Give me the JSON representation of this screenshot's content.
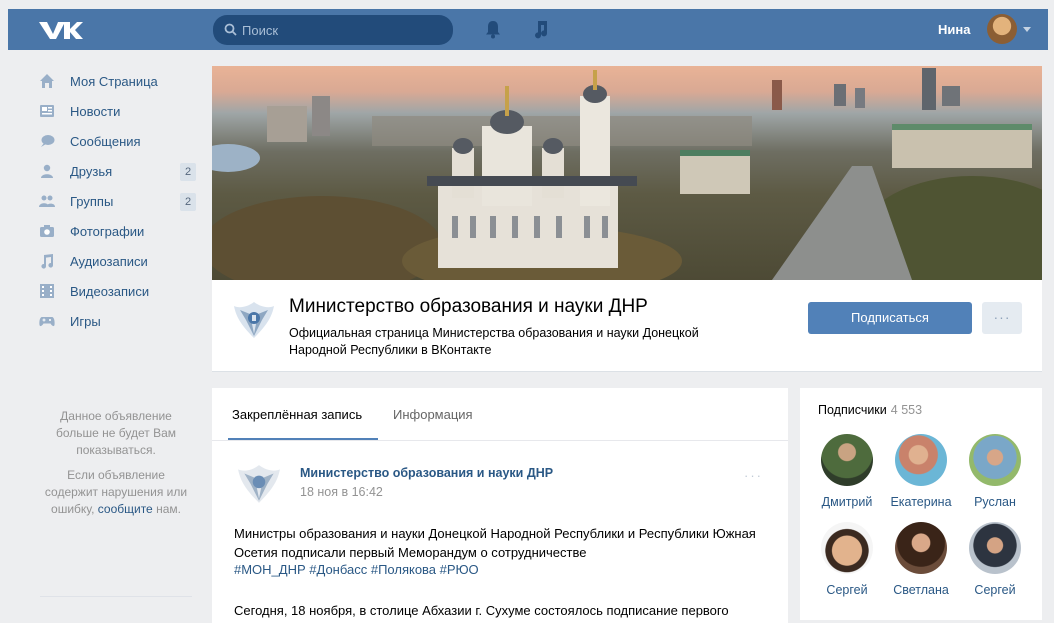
{
  "header": {
    "search_placeholder": "Поиск",
    "user_name": "Нина",
    "accent": "#4a76a8"
  },
  "sidebar": {
    "items": [
      {
        "label": "Моя Страница",
        "icon": "home-icon"
      },
      {
        "label": "Новости",
        "icon": "news-icon"
      },
      {
        "label": "Сообщения",
        "icon": "messages-icon"
      },
      {
        "label": "Друзья",
        "icon": "friends-icon",
        "count": "2"
      },
      {
        "label": "Группы",
        "icon": "groups-icon",
        "count": "2"
      },
      {
        "label": "Фотографии",
        "icon": "camera-icon"
      },
      {
        "label": "Аудиозаписи",
        "icon": "music-icon"
      },
      {
        "label": "Видеозаписи",
        "icon": "video-icon"
      },
      {
        "label": "Игры",
        "icon": "gamepad-icon"
      }
    ]
  },
  "ad": {
    "line1": "Данное объявление больше не будет Вам показываться.",
    "line2_prefix": "Если объявление содержит нарушения или ошибку,",
    "line2_link": "сообщите",
    "line2_suffix": "нам."
  },
  "group": {
    "title": "Министерство образования и науки ДНР",
    "description": "Официальная страница Министерства образования и науки Донецкой Народной Республики в ВКонтакте",
    "subscribe_label": "Подписаться",
    "more_label": "···"
  },
  "post": {
    "tabs": [
      "Закреплённая запись",
      "Информация"
    ],
    "author": "Министерство образования и науки ДНР",
    "date": "18 ноя в 16:42",
    "menu_label": "···",
    "text": "Министры образования и науки Донецкой Народной Республики и Республики Южная Осетия подписали первый Меморандум о сотрудничестве",
    "tags": "#МОН_ДНР #Донбасс #Полякова #РЮО",
    "text2": "Сегодня, 18 ноября, в столице Абхазии г. Сухуме состоялось подписание первого"
  },
  "subscribers": {
    "title": "Подписчики",
    "count": "4 553",
    "people": [
      {
        "name": "Дмитрий"
      },
      {
        "name": "Екатерина"
      },
      {
        "name": "Руслан"
      },
      {
        "name": "Сергей"
      },
      {
        "name": "Светлана"
      },
      {
        "name": "Сергей"
      }
    ]
  }
}
